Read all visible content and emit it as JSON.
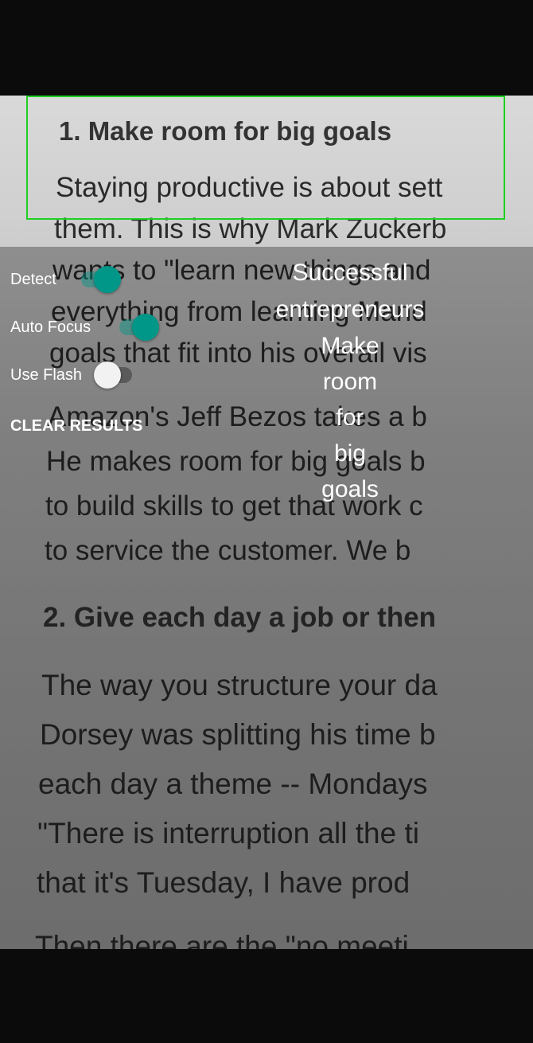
{
  "document": {
    "lines": [
      "1. Make room for big goals",
      "Staying productive is about sett",
      "them. This is why Mark Zuckerb",
      "wants to \"learn new things and",
      "everything from learning Mand",
      "goals that fit into his overall vis",
      "Amazon's Jeff Bezos takes a b",
      "He makes room for big goals b",
      "to build skills to get that work c",
      "to service the customer. We b",
      "2. Give each day a job or then",
      "The way you structure your da",
      "Dorsey was splitting his time b",
      "each day a theme -- Mondays",
      "\"There is interruption all the ti",
      "that it's Tuesday, I have prod",
      "Then there are the \"no meeti"
    ]
  },
  "controls": {
    "detect": {
      "label": "Detect",
      "on": true
    },
    "auto_focus": {
      "label": "Auto Focus",
      "on": true
    },
    "use_flash": {
      "label": "Use Flash",
      "on": false
    },
    "clear_label": "CLEAR RESULTS"
  },
  "results": [
    "Successful",
    "entrepreneurs",
    "Make",
    "room",
    "for",
    "big",
    "goals"
  ],
  "colors": {
    "detect_box": "#1fd01f",
    "switch_on": "#009688"
  }
}
